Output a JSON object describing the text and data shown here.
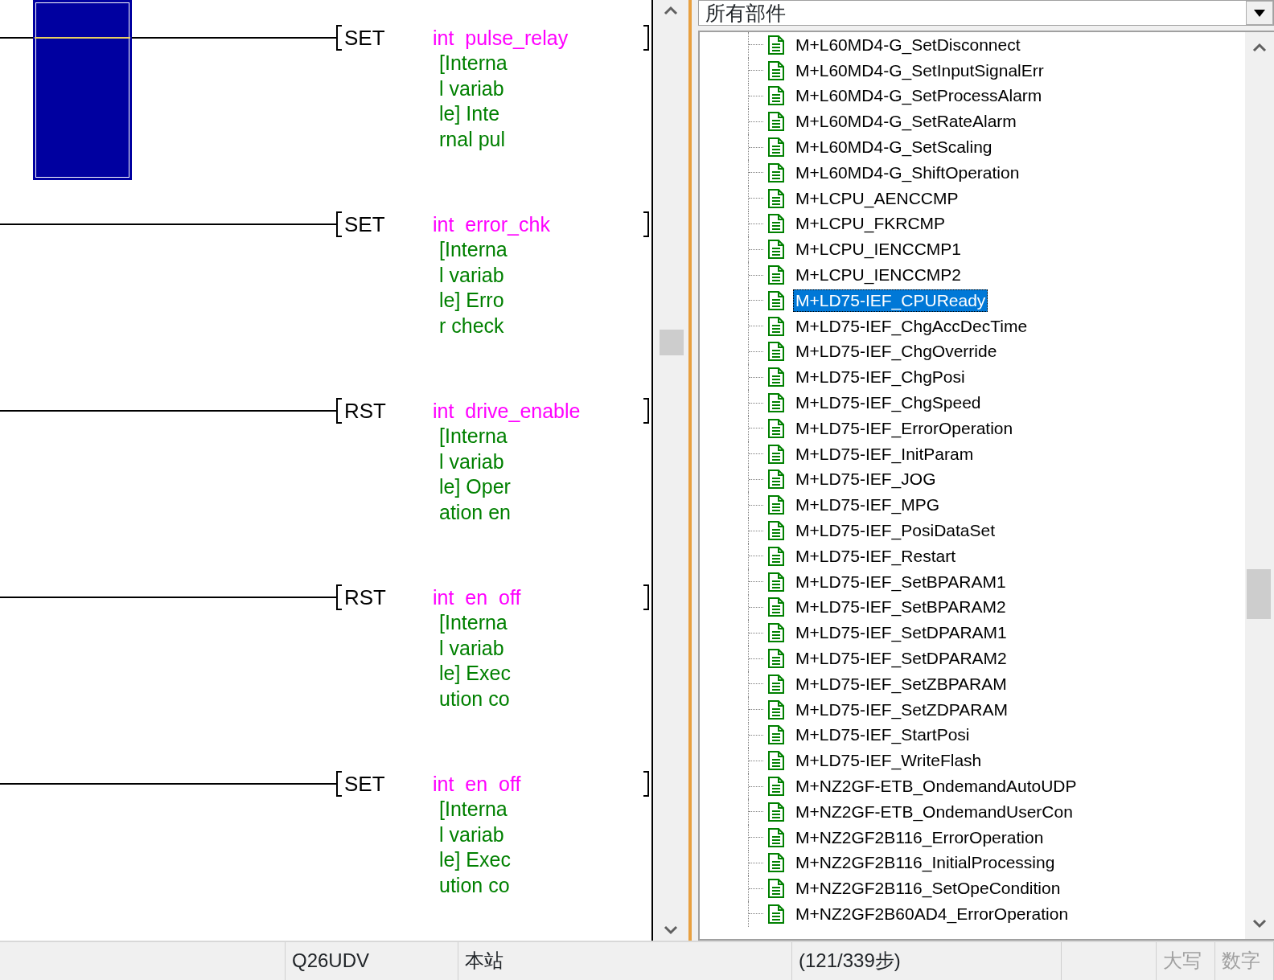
{
  "ladder": {
    "rungs": [
      {
        "instruction": "SET",
        "operand": "int  pulse_relay",
        "comment": [
          "[Interna",
          "l variab",
          "le] Inte",
          "rnal pul"
        ],
        "cursor": true
      },
      {
        "instruction": "SET",
        "operand": "int  error_chk",
        "comment": [
          "[Interna",
          "l variab",
          "le] Erro",
          "r check"
        ],
        "cursor": false
      },
      {
        "instruction": "RST",
        "operand": "int  drive_enable",
        "comment": [
          "[Interna",
          "l variab",
          "le] Oper",
          "ation en"
        ],
        "cursor": false
      },
      {
        "instruction": "RST",
        "operand": "int  en  off",
        "comment": [
          "[Interna",
          "l variab",
          "le] Exec",
          "ution co"
        ],
        "cursor": false
      },
      {
        "instruction": "SET",
        "operand": "int  en  off",
        "comment": [
          "[Interna",
          "l variab",
          "le] Exec",
          "ution co"
        ],
        "cursor": false
      }
    ]
  },
  "parts_panel": {
    "filter": {
      "value": "所有部件"
    },
    "tree": {
      "items": [
        {
          "label": "M+L60MD4-G_SetDisconnect",
          "selected": false
        },
        {
          "label": "M+L60MD4-G_SetInputSignalErr",
          "selected": false
        },
        {
          "label": "M+L60MD4-G_SetProcessAlarm",
          "selected": false
        },
        {
          "label": "M+L60MD4-G_SetRateAlarm",
          "selected": false
        },
        {
          "label": "M+L60MD4-G_SetScaling",
          "selected": false
        },
        {
          "label": "M+L60MD4-G_ShiftOperation",
          "selected": false
        },
        {
          "label": "M+LCPU_AENCCMP",
          "selected": false
        },
        {
          "label": "M+LCPU_FKRCMP",
          "selected": false
        },
        {
          "label": "M+LCPU_IENCCMP1",
          "selected": false
        },
        {
          "label": "M+LCPU_IENCCMP2",
          "selected": false
        },
        {
          "label": "M+LD75-IEF_CPUReady",
          "selected": true
        },
        {
          "label": "M+LD75-IEF_ChgAccDecTime",
          "selected": false
        },
        {
          "label": "M+LD75-IEF_ChgOverride",
          "selected": false
        },
        {
          "label": "M+LD75-IEF_ChgPosi",
          "selected": false
        },
        {
          "label": "M+LD75-IEF_ChgSpeed",
          "selected": false
        },
        {
          "label": "M+LD75-IEF_ErrorOperation",
          "selected": false
        },
        {
          "label": "M+LD75-IEF_InitParam",
          "selected": false
        },
        {
          "label": "M+LD75-IEF_JOG",
          "selected": false
        },
        {
          "label": "M+LD75-IEF_MPG",
          "selected": false
        },
        {
          "label": "M+LD75-IEF_PosiDataSet",
          "selected": false
        },
        {
          "label": "M+LD75-IEF_Restart",
          "selected": false
        },
        {
          "label": "M+LD75-IEF_SetBPARAM1",
          "selected": false
        },
        {
          "label": "M+LD75-IEF_SetBPARAM2",
          "selected": false
        },
        {
          "label": "M+LD75-IEF_SetDPARAM1",
          "selected": false
        },
        {
          "label": "M+LD75-IEF_SetDPARAM2",
          "selected": false
        },
        {
          "label": "M+LD75-IEF_SetZBPARAM",
          "selected": false
        },
        {
          "label": "M+LD75-IEF_SetZDPARAM",
          "selected": false
        },
        {
          "label": "M+LD75-IEF_StartPosi",
          "selected": false
        },
        {
          "label": "M+LD75-IEF_WriteFlash",
          "selected": false
        },
        {
          "label": "M+NZ2GF-ETB_OndemandAutoUDP",
          "selected": false
        },
        {
          "label": "M+NZ2GF-ETB_OndemandUserCon",
          "selected": false
        },
        {
          "label": "M+NZ2GF2B116_ErrorOperation",
          "selected": false
        },
        {
          "label": "M+NZ2GF2B116_InitialProcessing",
          "selected": false
        },
        {
          "label": "M+NZ2GF2B116_SetOpeCondition",
          "selected": false
        },
        {
          "label": "M+NZ2GF2B60AD4_ErrorOperation",
          "selected": false
        }
      ]
    }
  },
  "status_bar": {
    "cpu": "Q26UDV",
    "station": "本站",
    "steps": "(121/339步)",
    "indicators": [
      {
        "label": "大写",
        "active": false
      },
      {
        "label": "数字",
        "active": false
      }
    ]
  }
}
